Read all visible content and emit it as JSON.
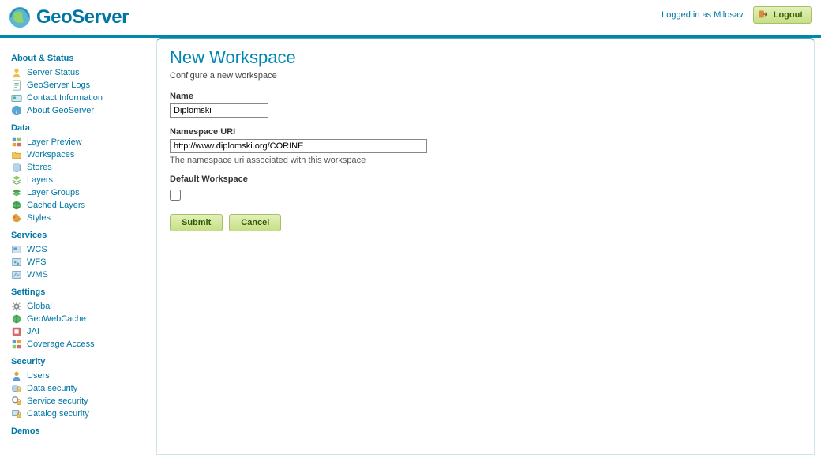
{
  "header": {
    "brand": "GeoServer",
    "logged_in_text": "Logged in as Milosav.",
    "logout_label": "Logout"
  },
  "sidebar": {
    "sections": [
      {
        "title": "About & Status",
        "items": [
          {
            "label": "Server Status",
            "icon": "info-person"
          },
          {
            "label": "GeoServer Logs",
            "icon": "doc-lines"
          },
          {
            "label": "Contact Information",
            "icon": "card"
          },
          {
            "label": "About GeoServer",
            "icon": "info-circle"
          }
        ]
      },
      {
        "title": "Data",
        "items": [
          {
            "label": "Layer Preview",
            "icon": "grid"
          },
          {
            "label": "Workspaces",
            "icon": "folder"
          },
          {
            "label": "Stores",
            "icon": "db"
          },
          {
            "label": "Layers",
            "icon": "stack"
          },
          {
            "label": "Layer Groups",
            "icon": "layers-green"
          },
          {
            "label": "Cached Layers",
            "icon": "globe-green"
          },
          {
            "label": "Styles",
            "icon": "palette"
          }
        ]
      },
      {
        "title": "Services",
        "items": [
          {
            "label": "WCS",
            "icon": "wcs"
          },
          {
            "label": "WFS",
            "icon": "wfs"
          },
          {
            "label": "WMS",
            "icon": "wms"
          }
        ]
      },
      {
        "title": "Settings",
        "items": [
          {
            "label": "Global",
            "icon": "gear"
          },
          {
            "label": "GeoWebCache",
            "icon": "globe-green"
          },
          {
            "label": "JAI",
            "icon": "jai"
          },
          {
            "label": "Coverage Access",
            "icon": "coverage"
          }
        ]
      },
      {
        "title": "Security",
        "items": [
          {
            "label": "Users",
            "icon": "user"
          },
          {
            "label": "Data security",
            "icon": "lock-data"
          },
          {
            "label": "Service security",
            "icon": "lock-service"
          },
          {
            "label": "Catalog security",
            "icon": "lock-catalog"
          }
        ]
      },
      {
        "title": "Demos",
        "items": []
      }
    ]
  },
  "main": {
    "title": "New Workspace",
    "description": "Configure a new workspace",
    "name_label": "Name",
    "name_value": "Diplomski",
    "namespace_label": "Namespace URI",
    "namespace_value": "http://www.diplomski.org/CORINE",
    "namespace_help": "The namespace uri associated with this workspace",
    "default_ws_label": "Default Workspace",
    "default_ws_checked": false,
    "submit_label": "Submit",
    "cancel_label": "Cancel"
  }
}
